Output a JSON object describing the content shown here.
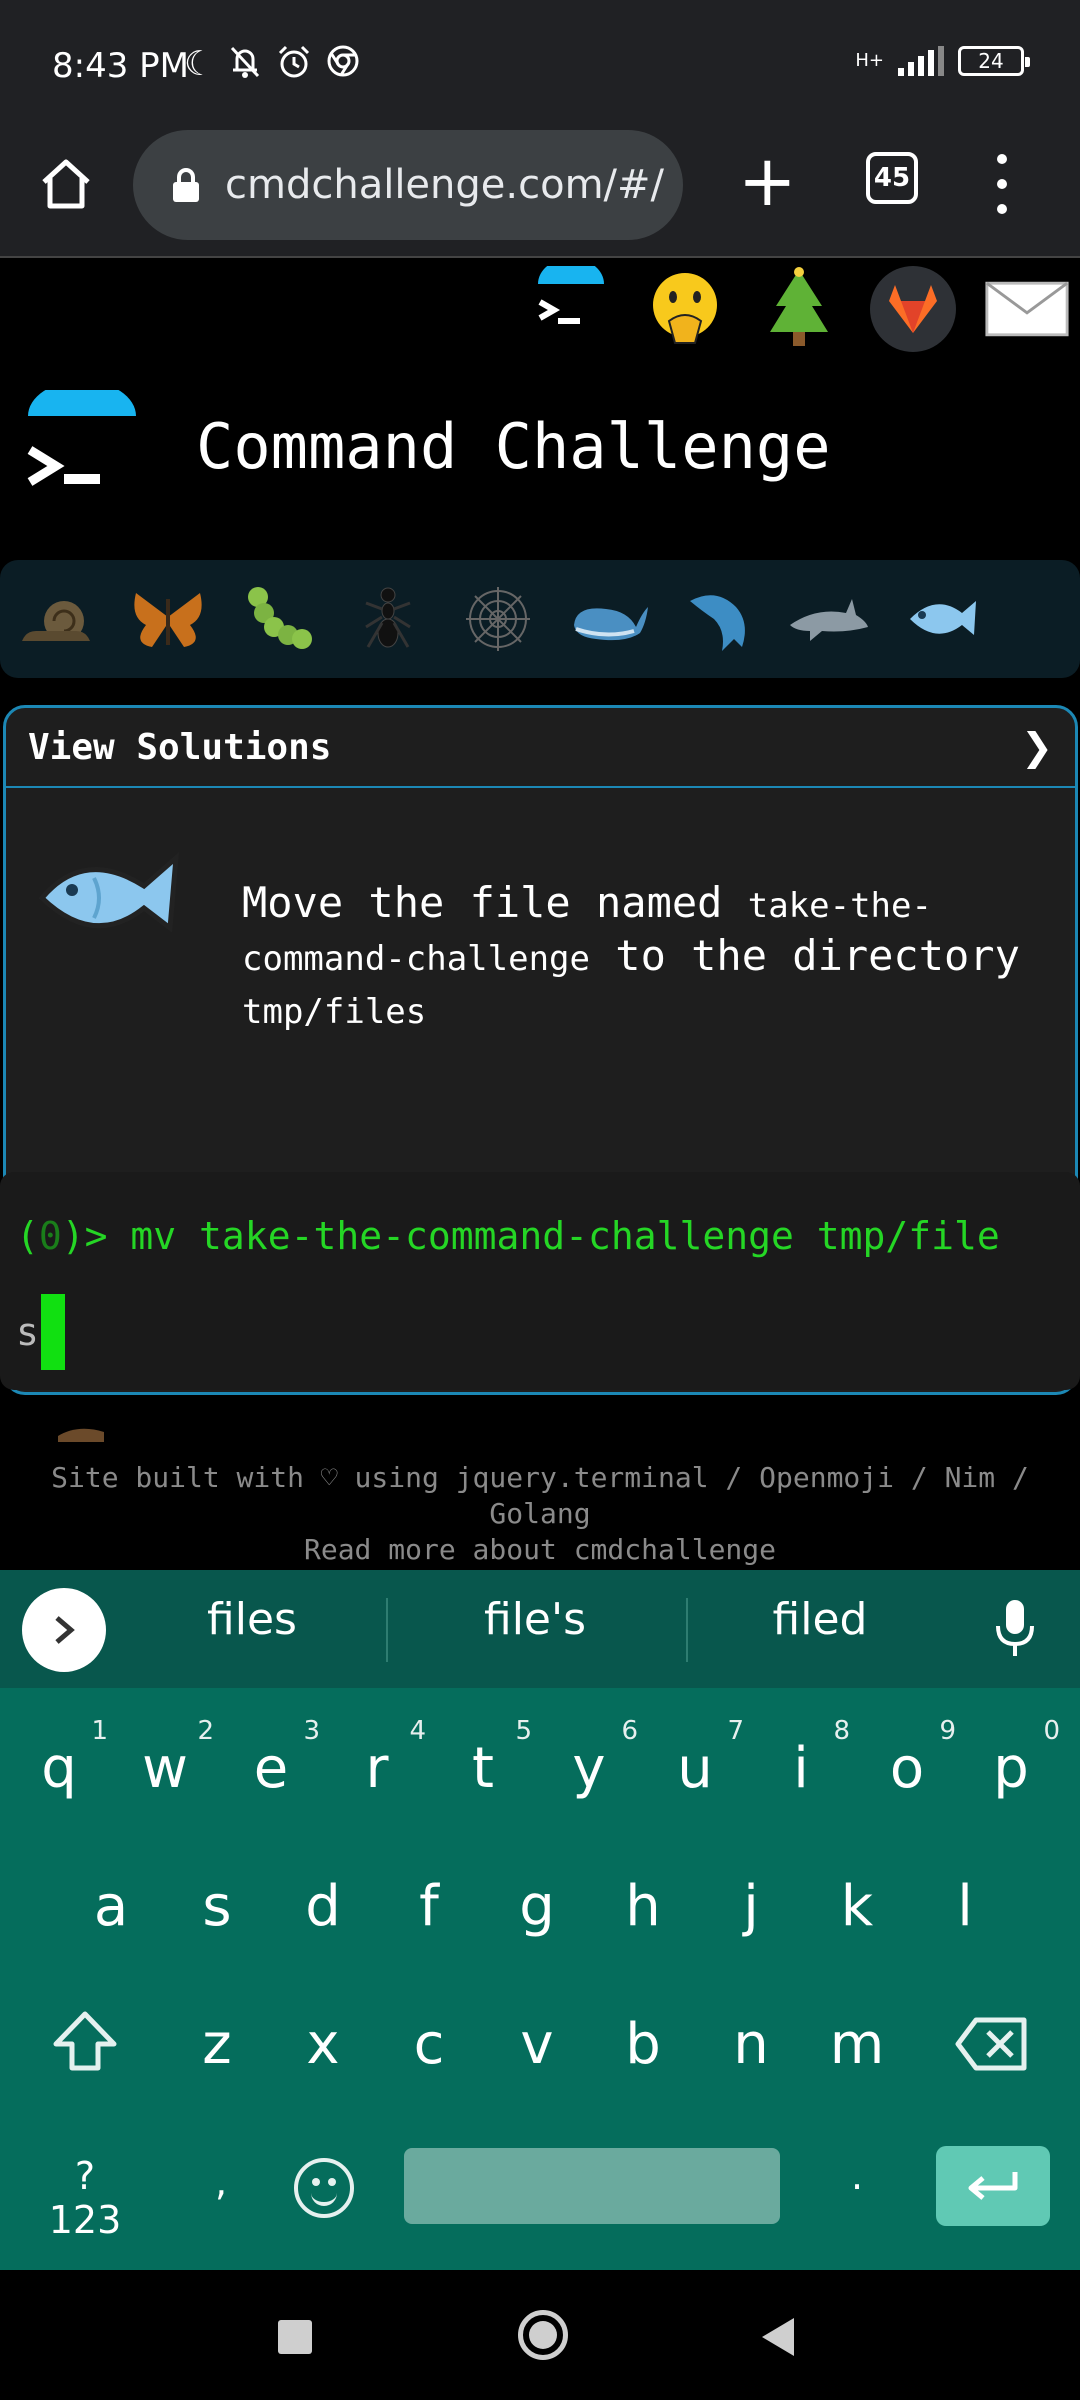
{
  "status_bar": {
    "time": "8:43 PM",
    "network": "H+",
    "battery": "24",
    "icons": [
      "moon-icon",
      "bell-off-icon",
      "alarm-icon",
      "chrome-icon"
    ]
  },
  "browser": {
    "url": "cmdchallenge.com/#/",
    "tab_count": "45"
  },
  "page": {
    "title": "Command Challenge",
    "top_icons": [
      "terminal-logo",
      "face-hand-over-mouth",
      "christmas-tree",
      "gitlab",
      "envelope"
    ],
    "levels": [
      "snail",
      "butterfly",
      "caterpillar",
      "ant",
      "spider-web",
      "whale",
      "dolphin-blue",
      "dolphin-grey",
      "fish"
    ],
    "card": {
      "header": "View Solutions",
      "chevron": "❯",
      "text_1": "Move the file named ",
      "code_1": "take-the-command-challenge",
      "text_2": " to the directory ",
      "code_2": "tmp/files"
    },
    "terminal": {
      "prompt_open": "(",
      "prompt_num": "0",
      "prompt_close": ")> ",
      "command": "mv take-the-command-challenge tmp/file",
      "wrap": "s"
    },
    "footer": {
      "line1": "Site built with ♡ using jquery.terminal / Openmoji / Nim /",
      "line2": "Golang",
      "line3": "Read more about cmdchallenge"
    }
  },
  "keyboard": {
    "suggestions": [
      "files",
      "file's",
      "filed"
    ],
    "row1": [
      "q",
      "w",
      "e",
      "r",
      "t",
      "y",
      "u",
      "i",
      "o",
      "p"
    ],
    "row1_nums": [
      "1",
      "2",
      "3",
      "4",
      "5",
      "6",
      "7",
      "8",
      "9",
      "0"
    ],
    "row2": [
      "a",
      "s",
      "d",
      "f",
      "g",
      "h",
      "j",
      "k",
      "l"
    ],
    "row3": [
      "z",
      "x",
      "c",
      "v",
      "b",
      "n",
      "m"
    ],
    "symbols_key": "?123",
    "comma_key": ",",
    "period_key": ".",
    "accent_color": "#056d5c"
  }
}
